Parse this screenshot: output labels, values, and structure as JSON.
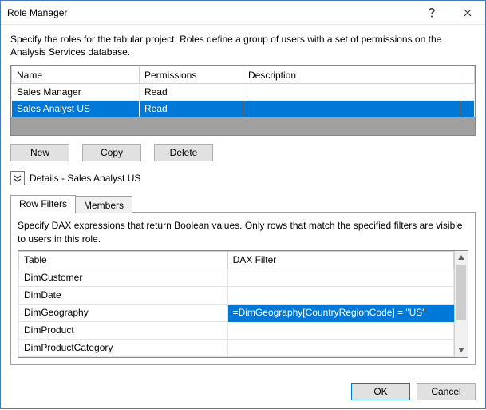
{
  "window": {
    "title": "Role Manager"
  },
  "intro": "Specify the roles for the tabular project. Roles define a group of users with a set of permissions on the Analysis Services database.",
  "rolesTable": {
    "headers": {
      "name": "Name",
      "permissions": "Permissions",
      "description": "Description"
    },
    "rows": [
      {
        "name": "Sales Manager",
        "permissions": "Read",
        "description": "",
        "selected": false
      },
      {
        "name": "Sales Analyst US",
        "permissions": "Read",
        "description": "",
        "selected": true
      }
    ]
  },
  "buttons": {
    "new": "New",
    "copy": "Copy",
    "delete": "Delete",
    "ok": "OK",
    "cancel": "Cancel"
  },
  "details": {
    "label": "Details - Sales Analyst US"
  },
  "tabs": {
    "rowFilters": "Row Filters",
    "members": "Members"
  },
  "filtersIntro": "Specify DAX expressions that return Boolean values. Only rows that match the specified filters are visible to users in this role.",
  "filtersTable": {
    "headers": {
      "table": "Table",
      "dax": "DAX Filter"
    },
    "rows": [
      {
        "table": "DimCustomer",
        "dax": "",
        "selected": false
      },
      {
        "table": "DimDate",
        "dax": "",
        "selected": false
      },
      {
        "table": "DimGeography",
        "dax": "=DimGeography[CountryRegionCode] = \"US\"",
        "selected": true
      },
      {
        "table": "DimProduct",
        "dax": "",
        "selected": false
      },
      {
        "table": "DimProductCategory",
        "dax": "",
        "selected": false
      }
    ]
  }
}
